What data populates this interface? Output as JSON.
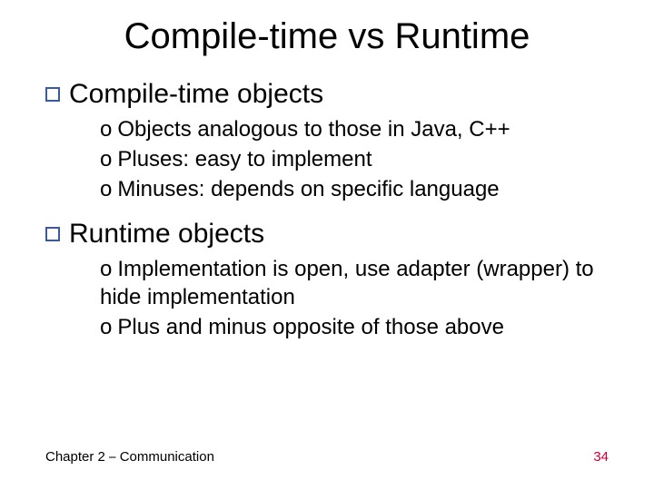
{
  "title": "Compile-time vs Runtime",
  "sections": [
    {
      "heading": "Compile-time objects",
      "items": [
        "Objects analogous to those in Java, C++",
        "Pluses: easy to implement",
        "Minuses: depends on specific language"
      ]
    },
    {
      "heading": "Runtime objects",
      "items": [
        "Implementation is open, use adapter (wrapper) to hide implementation",
        "Plus and minus opposite of those above"
      ]
    }
  ],
  "footer": {
    "left": "Chapter 2 ⎯ Communication",
    "right": "34"
  },
  "bullet": {
    "sub": "o"
  }
}
